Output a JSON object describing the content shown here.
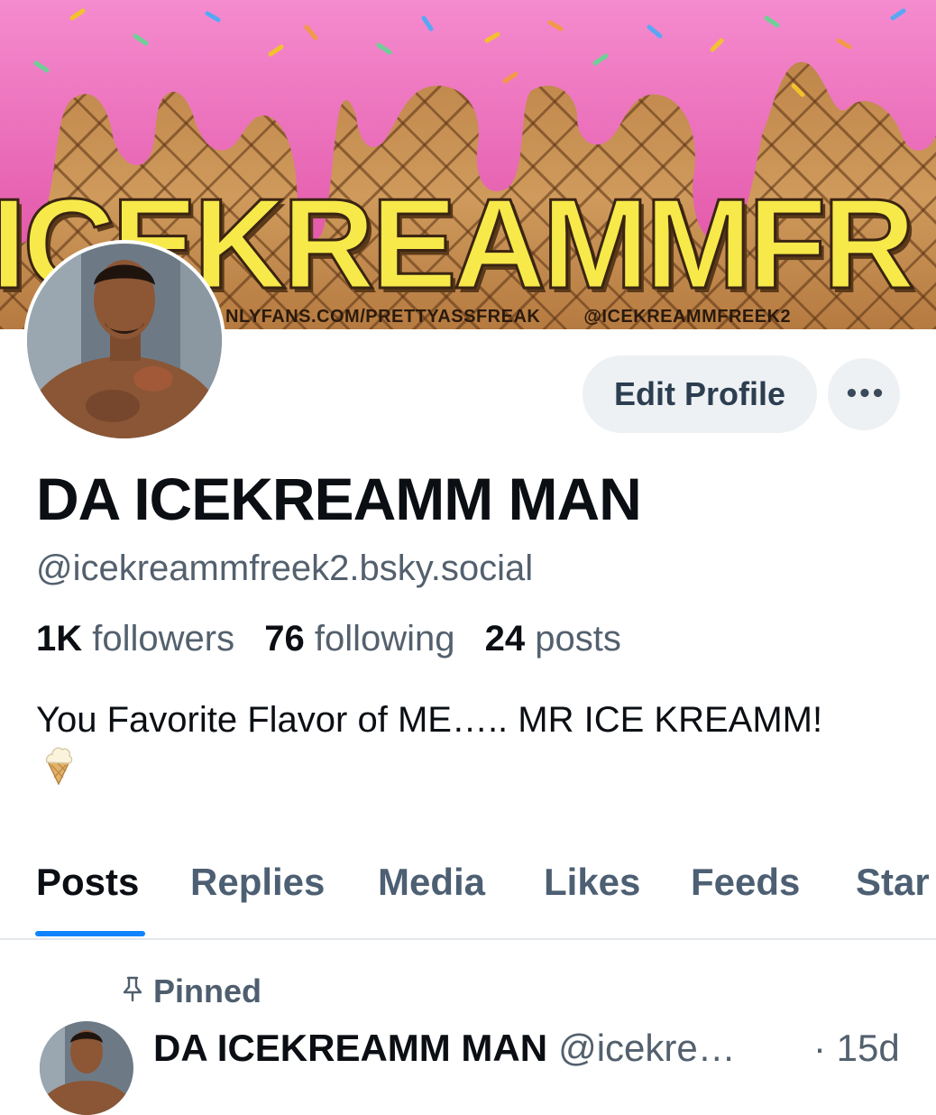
{
  "banner": {
    "title": "ICEKREAMMFR",
    "footer_link": "NLYFANS.COM/PRETTYASSFREAK",
    "footer_handle": "@ICEKREAMMFREEK2",
    "colors": {
      "cone": "#c48a4e",
      "icing": "#f27bc4",
      "text": "#f7e94a"
    }
  },
  "profile": {
    "display_name": "DA ICEKREAMM MAN",
    "handle": "@icekreammfreek2.bsky.social",
    "stats": {
      "followers_count": "1K",
      "followers_label": "followers",
      "following_count": "76",
      "following_label": "following",
      "posts_count": "24",
      "posts_label": "posts"
    },
    "bio": "You Favorite Flavor of ME….. MR ICE KREAMM!",
    "bio_emoji": "ice-cream-cone-icon"
  },
  "actions": {
    "edit_profile_label": "Edit Profile",
    "more_label": "•••"
  },
  "tabs": [
    {
      "label": "Posts",
      "active": true
    },
    {
      "label": "Replies"
    },
    {
      "label": "Media"
    },
    {
      "label": "Likes"
    },
    {
      "label": "Feeds"
    },
    {
      "label": "Star"
    }
  ],
  "pinned_post": {
    "pinned_label": "Pinned",
    "author_name": "DA ICEKREAMM MAN",
    "author_handle": "@icekre…",
    "time": "· 15d"
  },
  "theme": {
    "accent": "#1083fe",
    "muted": "#53606e",
    "button_bg": "#eef1f4"
  }
}
